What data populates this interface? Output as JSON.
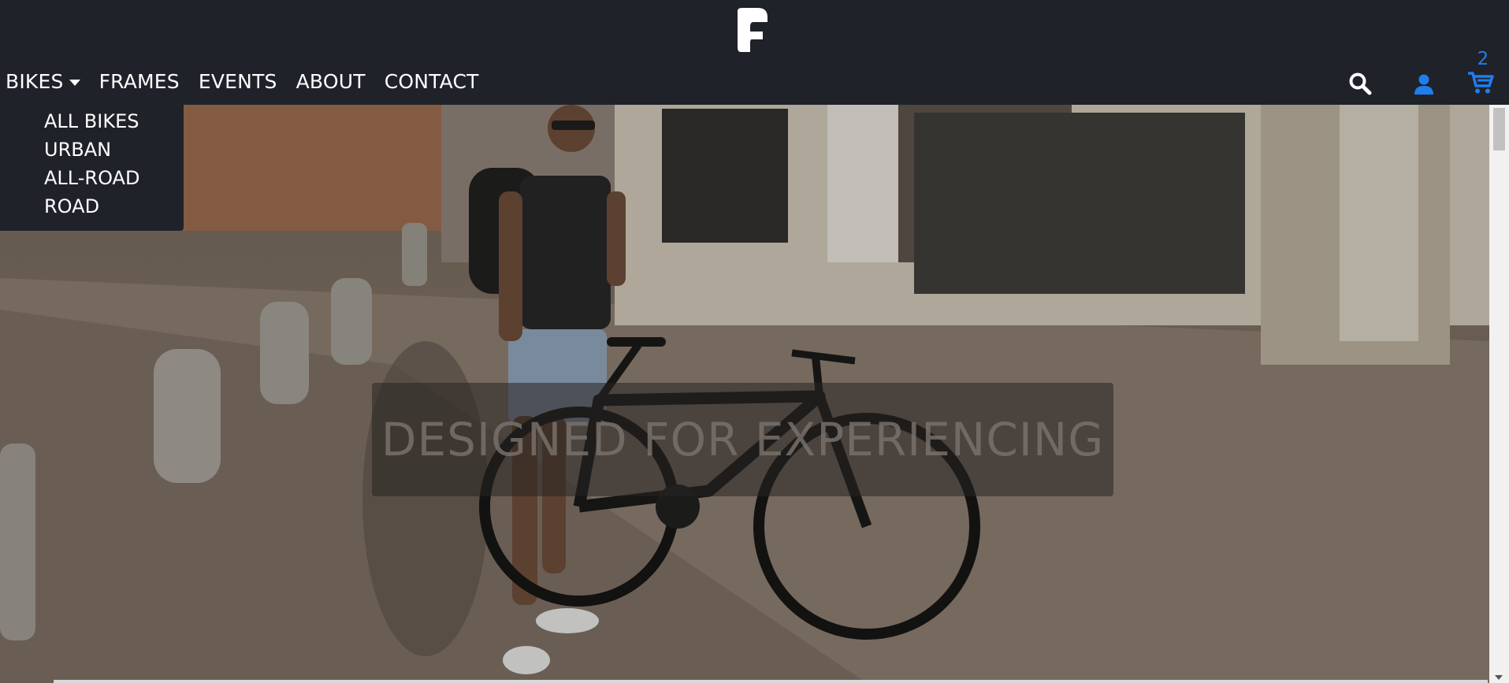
{
  "nav": {
    "items": [
      {
        "label": "BIKES",
        "has_dropdown": true
      },
      {
        "label": "FRAMES"
      },
      {
        "label": "EVENTS"
      },
      {
        "label": "ABOUT"
      },
      {
        "label": "CONTACT"
      }
    ]
  },
  "dropdown": {
    "items": [
      "ALL BIKES",
      "URBAN",
      "ALL-ROAD",
      "ROAD"
    ]
  },
  "icons": {
    "logo": "brand-logo-icon",
    "search": "search-icon",
    "account": "user-icon",
    "cart": "shopping-cart-icon"
  },
  "cart": {
    "count": "2"
  },
  "hero": {
    "banner_text": "DESIGNED FOR EXPERIENCING",
    "image": "man-with-black-bike-on-street"
  },
  "colors": {
    "header_bg": "#1f2229",
    "accent": "#1e7ef0",
    "nav_text": "#ffffff"
  }
}
